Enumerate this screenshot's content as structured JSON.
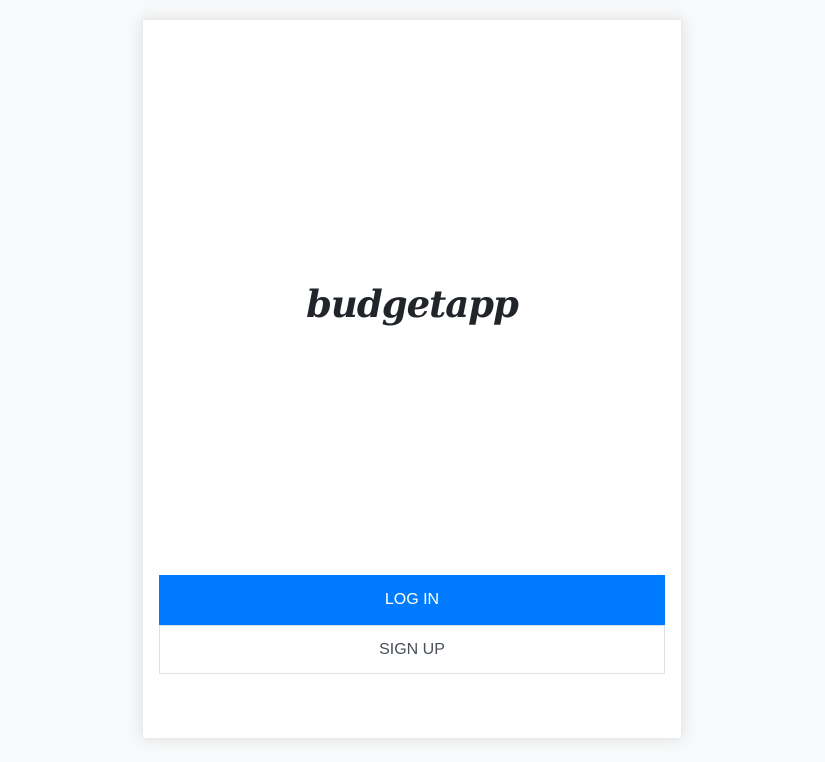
{
  "app": {
    "logo_text": "budgetapp"
  },
  "auth": {
    "login_label": "LOG IN",
    "signup_label": "SIGN UP"
  },
  "colors": {
    "primary": "#007bff",
    "page_background": "#f8f9fa",
    "card_background": "#ffffff",
    "logo_text": "#212529"
  }
}
